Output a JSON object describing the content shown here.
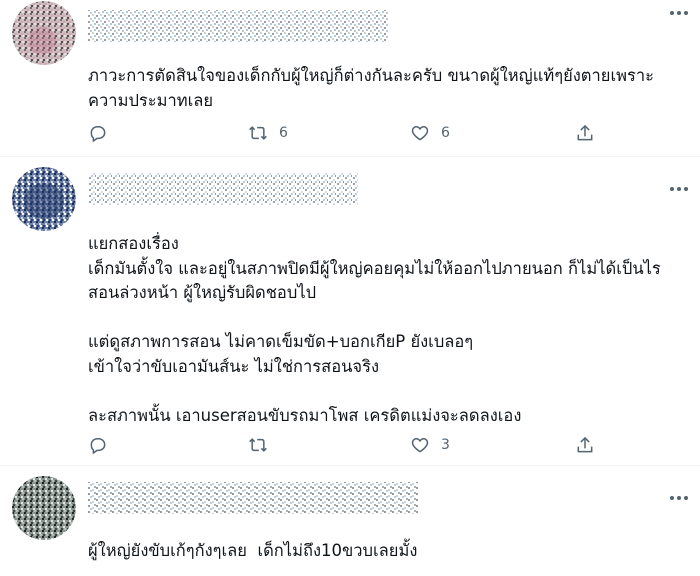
{
  "tweets": [
    {
      "text": "ภาวะการตัดสินใจของเด็กกับผู้ใหญ่ก็ต่างกันละครับ ขนาดผู้ใหญ่แท้ๆยังตายเพราะ\nความประมาทเลย",
      "reply_count": "",
      "retweet_count": "6",
      "like_count": "6",
      "avatar_icon": "pixelated-avatar",
      "avatar_color": "#b8a7a9"
    },
    {
      "text": "แยกสองเรื่อง\nเด็กมันตั้งใจ และอยู่ในสภาพปิดมีผู้ใหญ่คอยคุมไม่ให้ออกไปภายนอก ก็ไม่ได้เป็นไร\nสอนล่วงหน้า ผู้ใหญ่รับผิดชอบไป\n\nแต่ดูสภาพการสอน ไม่คาดเข็มขัด+บอกเกียP ยังเบลอๆ\nเข้าใจว่าขับเอามันส์นะ ไม่ใช่การสอนจริง\n\nละสภาพนั้น เอาuserสอนขับรถมาโพส เครดิตแม่งจะลดลงเอง",
      "reply_count": "",
      "retweet_count": "",
      "like_count": "3",
      "avatar_icon": "pixelated-avatar",
      "avatar_color": "#2f4a7a"
    },
    {
      "text": "ผู้ใหญ่ยังขับเก้ๆกังๆเลย  เด็กไม่ถึง10ขวบเลยมั้ง",
      "avatar_icon": "pixelated-avatar",
      "avatar_color": "#6a7270"
    }
  ],
  "icons": {
    "reply": "reply-icon",
    "retweet": "retweet-icon",
    "like": "heart-icon",
    "share": "share-icon",
    "more": "more-icon"
  },
  "colors": {
    "text": "#0f1419",
    "muted": "#536471",
    "divider": "#eff3f4"
  }
}
